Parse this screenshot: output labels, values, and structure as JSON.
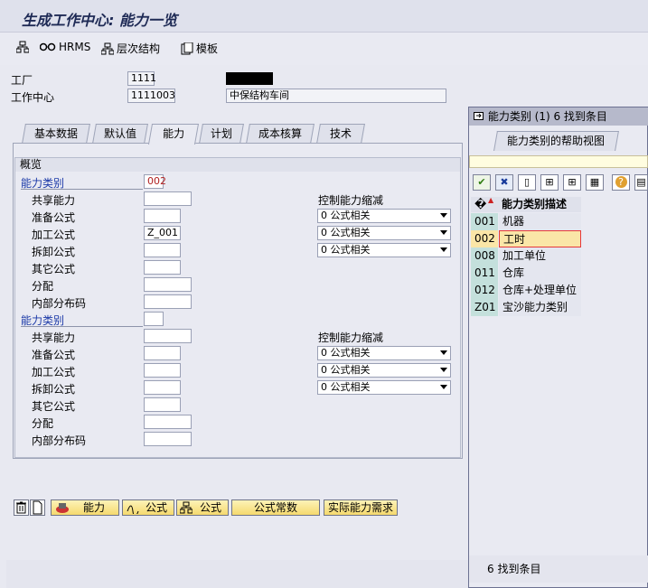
{
  "window": {
    "title": "生成工作中心: 能力一览"
  },
  "toolbar": {
    "items": [
      {
        "label": "",
        "icon": "hierarchy-icon"
      },
      {
        "label": "HRMS",
        "icon": "glasses-icon"
      },
      {
        "label": "层次结构",
        "icon": "tree-icon"
      },
      {
        "label": "模板",
        "icon": "template-icon"
      }
    ]
  },
  "header": {
    "plant_label": "工厂",
    "plant_value": "1111",
    "work_center_label": "工作中心",
    "work_center_value": "1111003",
    "work_center_desc": "中保结构车间"
  },
  "tabs": [
    "基本数据",
    "默认值",
    "能力",
    "计划",
    "成本核算",
    "技术"
  ],
  "overview": {
    "title": "概览",
    "section1": {
      "category_label": "能力类别",
      "category_value": "002",
      "rows": [
        {
          "label": "共享能力",
          "value": ""
        },
        {
          "label": "准备公式",
          "value": ""
        },
        {
          "label": "加工公式",
          "value": "Z_001"
        },
        {
          "label": "拆卸公式",
          "value": ""
        },
        {
          "label": "其它公式",
          "value": ""
        },
        {
          "label": "分配",
          "value": ""
        },
        {
          "label": "内部分布码",
          "value": ""
        }
      ],
      "reduce_label": "控制能力缩减",
      "reduce_values": [
        "0 公式相关",
        "0 公式相关",
        "0 公式相关"
      ]
    },
    "section2": {
      "category_label": "能力类别",
      "category_value": "",
      "rows": [
        {
          "label": "共享能力",
          "value": ""
        },
        {
          "label": "准备公式",
          "value": ""
        },
        {
          "label": "加工公式",
          "value": ""
        },
        {
          "label": "拆卸公式",
          "value": ""
        },
        {
          "label": "其它公式",
          "value": ""
        },
        {
          "label": "分配",
          "value": ""
        },
        {
          "label": "内部分布码",
          "value": ""
        }
      ],
      "reduce_label": "控制能力缩减",
      "reduce_values": [
        "0 公式相关",
        "0 公式相关",
        "0 公式相关"
      ]
    }
  },
  "buttons": {
    "capacity": "能力",
    "formula1": "公式",
    "formula2": "公式",
    "formula_constants": "公式常数",
    "actual_capacity": "实际能力需求"
  },
  "popup": {
    "title": "能力类别 (1)   6 找到条目",
    "tab": "能力类别的帮助视图",
    "column_header": "能力类别描述",
    "header_marker": "�",
    "rows": [
      {
        "key": "001",
        "desc": "机器"
      },
      {
        "key": "002",
        "desc": "工时"
      },
      {
        "key": "008",
        "desc": "加工单位"
      },
      {
        "key": "011",
        "desc": "仓库"
      },
      {
        "key": "012",
        "desc": "仓库+处理单位"
      },
      {
        "key": "Z01",
        "desc": "宝沙能力类别"
      }
    ],
    "selected_key": "002",
    "status": "6 找到条目"
  },
  "colors": {
    "accent": "#1c3aa8",
    "highlight": "#fae6a7",
    "selection_border": "#e5383b"
  }
}
